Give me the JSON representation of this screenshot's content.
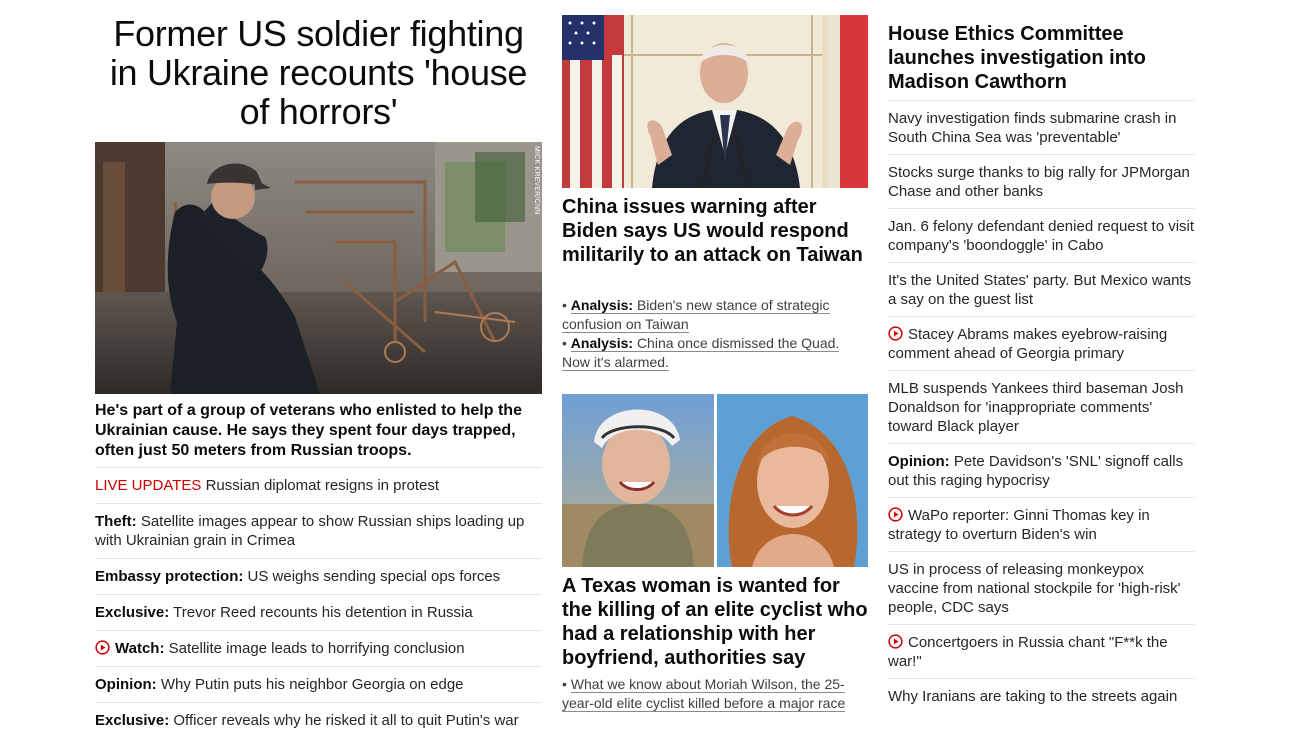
{
  "lead": {
    "headline": "Former US soldier fighting in Ukraine recounts 'house of horrors'",
    "photo_credit": "MICK KREVER/CNN",
    "dek": "He's part of a group of veterans who enlisted to help the Ukrainian cause. He says they spent four days trapped, often just 50 meters from Russian troops.",
    "items": [
      {
        "kicker": "LIVE UPDATES",
        "kicker_style": "red",
        "text": "Russian diplomat resigns in protest"
      },
      {
        "kicker": "Theft:",
        "kicker_style": "bold",
        "text": "Satellite images appear to show Russian ships loading up with Ukrainian grain in Crimea"
      },
      {
        "kicker": "Embassy protection:",
        "kicker_style": "bold",
        "text": "US weighs sending special ops forces"
      },
      {
        "kicker": "Exclusive:",
        "kicker_style": "bold",
        "text": "Trevor Reed recounts his detention in Russia"
      },
      {
        "kicker": "Watch:",
        "kicker_style": "bold",
        "text": "Satellite image leads to horrifying conclusion",
        "video": true
      },
      {
        "kicker": "Opinion:",
        "kicker_style": "bold",
        "text": "Why Putin puts his neighbor Georgia on edge"
      },
      {
        "kicker": "Exclusive:",
        "kicker_style": "bold",
        "text": "Officer reveals why he risked it all to quit Putin's war"
      }
    ]
  },
  "story2": {
    "headline": "China issues warning after Biden says US would respond militarily to an attack on Taiwan",
    "subs": [
      {
        "kicker": "Analysis:",
        "text": "Biden's new stance of strategic confusion on Taiwan"
      },
      {
        "kicker": "Analysis:",
        "text": "China once dismissed the Quad. Now it's alarmed."
      }
    ]
  },
  "story3": {
    "headline": "A Texas woman is wanted for the killing of an elite cyclist who had a relationship with her boyfriend, authorities say",
    "subs": [
      {
        "kicker": "",
        "text": "What we know about Moriah Wilson, the 25-year-old elite cyclist killed before a major race"
      }
    ]
  },
  "right": {
    "headline": "House Ethics Committee launches investigation into Madison Cawthorn",
    "items": [
      {
        "kicker": "",
        "text": "Navy investigation finds submarine crash in South China Sea was 'preventable'"
      },
      {
        "kicker": "",
        "text": "Stocks surge thanks to big rally for JPMorgan Chase and other banks"
      },
      {
        "kicker": "",
        "text": "Jan. 6 felony defendant denied request to visit company's 'boondoggle' in Cabo"
      },
      {
        "kicker": "",
        "text": "It's the United States' party. But Mexico wants a say on the guest list"
      },
      {
        "kicker": "",
        "text": "Stacey Abrams makes eyebrow-raising comment ahead of Georgia primary",
        "video": true
      },
      {
        "kicker": "",
        "text": "MLB suspends Yankees third baseman Josh Donaldson for 'inappropriate comments' toward Black player"
      },
      {
        "kicker": "Opinion:",
        "text": "Pete Davidson's 'SNL' signoff calls out this raging hypocrisy"
      },
      {
        "kicker": "",
        "text": "WaPo reporter: Ginni Thomas key in strategy to overturn Biden's win",
        "video": true
      },
      {
        "kicker": "",
        "text": "US in process of releasing monkeypox vaccine from national stockpile for 'high-risk' people, CDC says"
      },
      {
        "kicker": "",
        "text": "Concertgoers in Russia chant \"F**k the war!\"",
        "video": true
      },
      {
        "kicker": "",
        "text": "Why Iranians are taking to the streets again"
      }
    ]
  },
  "colors": {
    "live_red": "#cc0000",
    "video_red": "#cc0000",
    "divider": "#e6e6e6",
    "text": "#0c0c0c"
  }
}
